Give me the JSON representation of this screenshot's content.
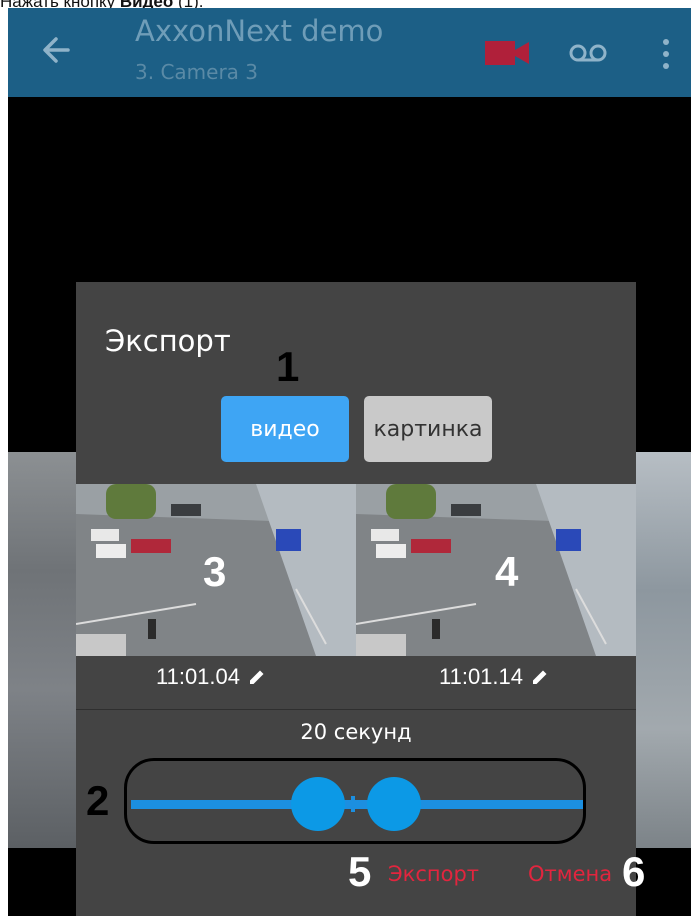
{
  "caption": {
    "prefix": "Нажать кнопку ",
    "bold": "Видео",
    "suffix": " (1)."
  },
  "appbar": {
    "title": "AxxonNext demo",
    "subtitle": "3. Camera 3",
    "icons": [
      "back-arrow-icon",
      "record-camera-icon",
      "voicemail-icon",
      "more-vertical-icon"
    ],
    "colors": {
      "bar": "#1c5f86",
      "record": "#b0203a"
    }
  },
  "dialog": {
    "heading": "Экспорт",
    "mode_buttons": {
      "video": "видео",
      "picture": "картинка"
    },
    "start_time": "11:01.04",
    "end_time": "11:01.14",
    "duration": "20 секунд",
    "export_label": "Экспорт",
    "cancel_label": "Отмена",
    "colors": {
      "accent": "#3ea5f4",
      "action": "#e2253e"
    }
  },
  "markers": {
    "m1": "1",
    "m2": "2",
    "m3": "3",
    "m4": "4",
    "m5": "5",
    "m6": "6"
  }
}
